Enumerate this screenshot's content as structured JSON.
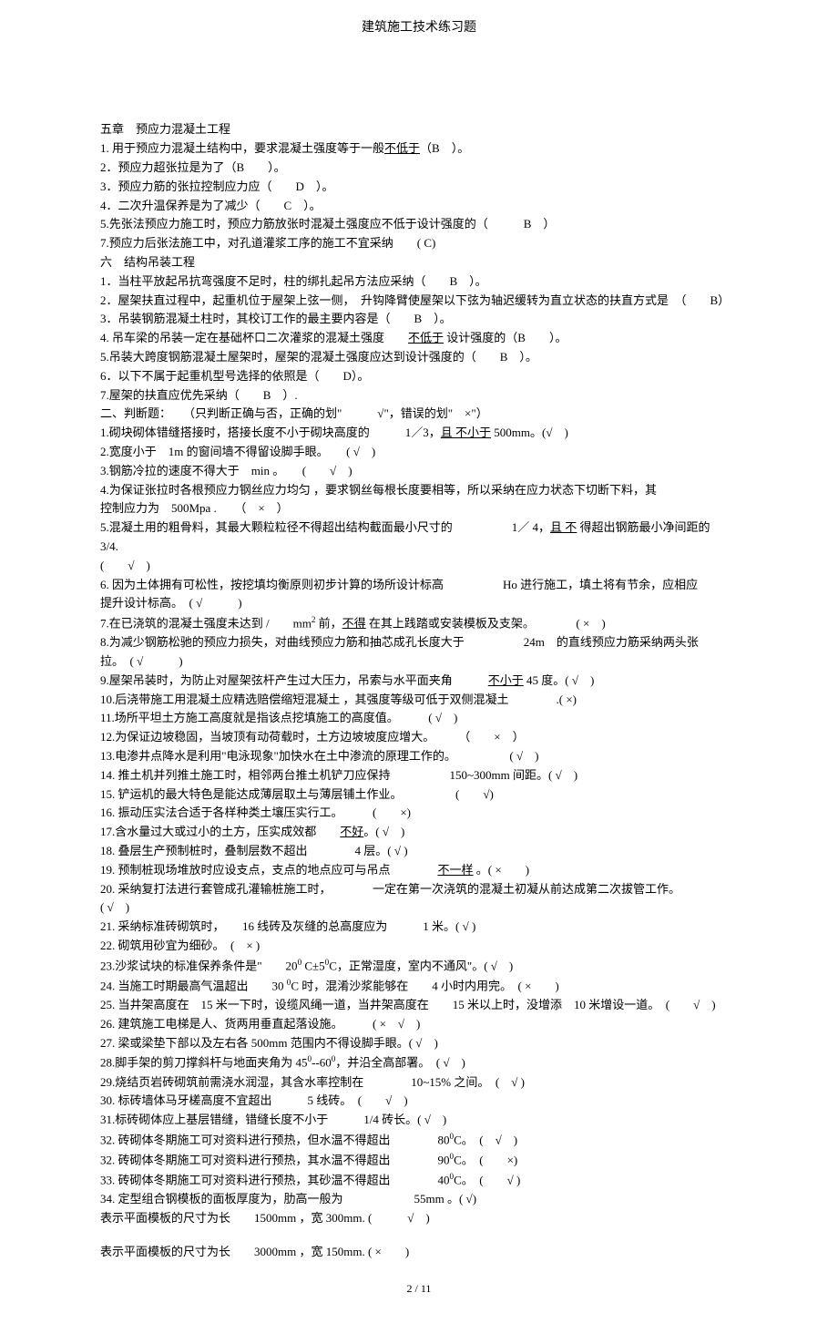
{
  "header": {
    "title": "建筑施工技术练习题"
  },
  "chapter5": {
    "title": "五章　预应力混凝土工程",
    "items": [
      {
        "pre": "1. 用于预应力混凝土结构中，要求混凝土强度等于一般",
        "ul": "不低于",
        "post": "（B　）。"
      },
      {
        "pre": "2．预应力超张拉是为了（B",
        "ul": "",
        "post": "　　）。"
      },
      {
        "pre": "3．预应力筋的张拉控制应力应（　　D",
        "ul": "",
        "post": "　）。"
      },
      {
        "pre": "4．二次升温保养是为了减少（",
        "ul": "",
        "post": "　　C　）。"
      },
      {
        "pre": "5.先张法预应力施工时，预应力筋放张时混凝土强度应不低于设计强度的（",
        "ul": "",
        "post": "　　　B　）"
      },
      {
        "pre": "7.预应力后张法施工中，对孔道灌浆工序的施工不宜采纳",
        "ul": "",
        "post": "　　( C)"
      }
    ]
  },
  "chapter6": {
    "title": "六　结构吊装工程",
    "items": [
      {
        "pre": "1．当柱平放起吊抗弯强度不足时，柱的绑扎起吊方法应采纳（",
        "ul": "",
        "post": "　　B　）。"
      },
      {
        "pre": "2．屋架扶直过程中，起重机位于屋架上弦一侧，　升钩降臂使屋架以下弦为轴迟缓转为直立状态的扶直方式是",
        "ul": "",
        "post": "　（　　B）"
      },
      {
        "pre": "3．吊装钢筋混凝土柱时，其校订工作的最主要内容是（",
        "ul": "",
        "post": "　　B　）。"
      },
      {
        "pre": "4. 吊车梁的吊装一定在基础杯口二次灌浆的混凝土强度　　",
        "ul": "不低于",
        "post": " 设计强度的（B　　）。"
      },
      {
        "pre": "5.吊装大跨度钢筋混凝土屋架时，屋架的混凝土强度应达到设计强度的（",
        "ul": "",
        "post": "　　B　）。"
      },
      {
        "pre": "6．以下不属于起重机型号选择的依照是（",
        "ul": "",
        "post": "　　D）。"
      },
      {
        "pre": "7.屋架的扶直应优先采纳（",
        "ul": "",
        "post": "　　B　）."
      }
    ]
  },
  "judge": {
    "title": "二、判断题：　　（只判断正确与否，正确的划\"　　　√\"，错误的划\"　×\"）",
    "items": [
      {
        "pre": "1.砌块砌体错缝搭接时，搭接长度不小于砌块高度的　　　1／3，",
        "ul": "且 不小于",
        "post": " 500mm。(√　)"
      },
      {
        "pre": "2.宽度小于　1m 的窗间墙不得留设脚手眼。　　( √　)",
        "ul": "",
        "post": ""
      },
      {
        "pre": "3.钢筋冷拉的速度不得大于　min 。　　(　　√　)",
        "ul": "",
        "post": ""
      },
      {
        "pre": "4.为保证张拉时各根预应力钢丝应力均匀 ，要求钢丝每根长度要相等，所以采纳在应力状态下切断下料，其",
        "ul": "",
        "post": ""
      },
      {
        "pre": "控制应力为　500Mpa .　　（　×　）",
        "ul": "",
        "post": ""
      },
      {
        "pre": "5.混凝土用的粗骨料，其最大颗粒粒径不得超出结构截面最小尺寸的　　　　　1／ 4，",
        "ul": "且 不",
        "post": " 得超出钢筋最小净间距的　　3/4."
      },
      {
        "pre": "(　　√　)",
        "ul": "",
        "post": ""
      },
      {
        "pre": "6. 因为土体拥有可松性，按挖填均衡原则初步计算的场所设计标高　　　　　Ho 进行施工，填土将有节余，应相应",
        "ul": "",
        "post": ""
      },
      {
        "pre": "提升设计标高。　( √　　　)",
        "ul": "",
        "post": ""
      },
      {
        "pre_html": "7.在已浇筑的混凝土强度未达到 /　　mm<sup>2</sup> 前，<span class='u'>不得</span> 在其上践踏或安装模板及支架。　　　　( ×　)"
      },
      {
        "pre": "8.为减少钢筋松驰的预应力损失，对曲线预应力筋和抽芯成孔长度大于　　　　　24m　的直线预应力筋采纳两头张",
        "ul": "",
        "post": ""
      },
      {
        "pre": "拉。　( √　　　)",
        "ul": "",
        "post": ""
      },
      {
        "pre": "9.屋架吊装时，为防止对屋架弦杆产生过大压力，吊索与水平面夹角　　　",
        "ul": "不小于",
        "post": " 45 度。( √　)"
      },
      {
        "pre": "10.后浇带施工用混凝土应精选赔偿缩短混凝土 ，其强度等级可低于双侧混凝土　　　　.( ×)",
        "ul": "",
        "post": ""
      },
      {
        "pre": "11.场所平坦土方施工高度就是指该点挖填施工的高度值。　　　( √　)",
        "ul": "",
        "post": ""
      },
      {
        "pre": "12.为保证边坡稳固，当坡顶有动荷载时，土方边坡坡度应增大。　　　（　　×　）",
        "ul": "",
        "post": ""
      },
      {
        "pre": "13.电渗井点降水是利用\"电泳现象\"加快水在土中渗流的原理工作的。　　　　　( √　)",
        "ul": "",
        "post": ""
      },
      {
        "pre": "14. 推土机并列推土施工时，相邻两台推土机铲刀应保持　　　　　150~300mm 间距。( √　)",
        "ul": "",
        "post": ""
      },
      {
        "pre": "15. 铲运机的最大特色是能达成薄层取土与薄层铺土作业。　　　　　(　　√)",
        "ul": "",
        "post": ""
      },
      {
        "pre": "16. 振动压实法合适于各样种类土壤压实行工。　　　(　　×)",
        "ul": "",
        "post": ""
      },
      {
        "pre": "17.含水量过大或过小的土方，压实成效都　　",
        "ul": "不好",
        "post": "。( √　)"
      },
      {
        "pre": "18. 叠层生产预制桩时，叠制层数不超出　　　　4 层。( √ )",
        "ul": "",
        "post": ""
      },
      {
        "pre": "19. 预制桩现场堆放时应设支点，支点的地点应可与吊点　　　　",
        "ul": "不一样",
        "post": " 。( ×　　)"
      },
      {
        "pre": "20. 采纳复打法进行套管成孔灌输桩施工时，　　　　一定在第一次浇筑的混凝土初凝从前达成第二次拔管工作。　　　　　　　　　　( √　)",
        "ul": "",
        "post": ""
      },
      {
        "pre": "21. 采纳标准砖砌筑时，　　16 线砖及灰缝的总高度应为　　　1 米。( √ )",
        "ul": "",
        "post": ""
      },
      {
        "pre": "22. 砌筑用砂宜为细砂。　(　× )",
        "ul": "",
        "post": ""
      },
      {
        "pre_html": "23.沙浆试块的标准保养条件是\"　　20<sup>0</sup> C±5<sup>0</sup>C，正常湿度，室内不通风\"。( √　)"
      },
      {
        "pre_html": "24. 当施工时期最高气温超出　　30 <sup>0</sup>C 时，混淆沙浆能够在　　4 小时内用完。　( ×　　)"
      },
      {
        "pre": "25. 当井架高度在　15 米一下时，设缆风绳一道，当井架高度在　　15 米以上时，没增添　10 米增设一道。　(　　√　)",
        "ul": "",
        "post": ""
      },
      {
        "pre": "26. 建筑施工电梯是人、货两用垂直起落设施。　　　( ×　√　)",
        "ul": "",
        "post": ""
      },
      {
        "pre": "27. 梁或梁垫下部以及左右各 500mm 范围内不得设脚手眼。( √　)",
        "ul": "",
        "post": ""
      },
      {
        "pre_html": "28.脚手架的剪刀撑斜杆与地面夹角为 45<sup>0</sup>--60<sup>0</sup>，并沿全高部署。　( √　)"
      },
      {
        "pre": "29.烧结页岩砖砌筑前需浇水润湿，其含水率控制在　　　　10~15% 之间。　(　√ )",
        "ul": "",
        "post": ""
      },
      {
        "pre": "30. 标砖墙体马牙槎高度不宜超出　　　5 线砖。　(　　√　)",
        "ul": "",
        "post": ""
      },
      {
        "pre": "31.标砖砌体应上基层错缝，错缝长度不小于　　　1/4 砖长。( √　)",
        "ul": "",
        "post": ""
      },
      {
        "pre_html": "32. 砖砌体冬期施工可对资料进行预热，但水温不得超出　　　　80<sup>0</sup>C。　(　√　)"
      },
      {
        "pre_html": "32. 砖砌体冬期施工可对资料进行预热，其水温不得超出　　　　90<sup>0</sup>C。　(　　×)"
      },
      {
        "pre_html": "33. 砖砌体冬期施工可对资料进行预热，其砂温不得超出　　　　40<sup>0</sup>C。　(　　√ )"
      },
      {
        "pre": "34. 定型组合钢模板的面板厚度为，肋高一般为　　　　　　55mm 。( √)",
        "ul": "",
        "post": ""
      },
      {
        "pre": "表示平面模板的尺寸为长　　1500mm ，宽  300mm. (　　　√　)",
        "ul": "",
        "post": ""
      }
    ],
    "last": "表示平面模板的尺寸为长　　3000mm ，宽  150mm. ( ×　　)"
  },
  "footer": {
    "text": "2 / 11"
  }
}
